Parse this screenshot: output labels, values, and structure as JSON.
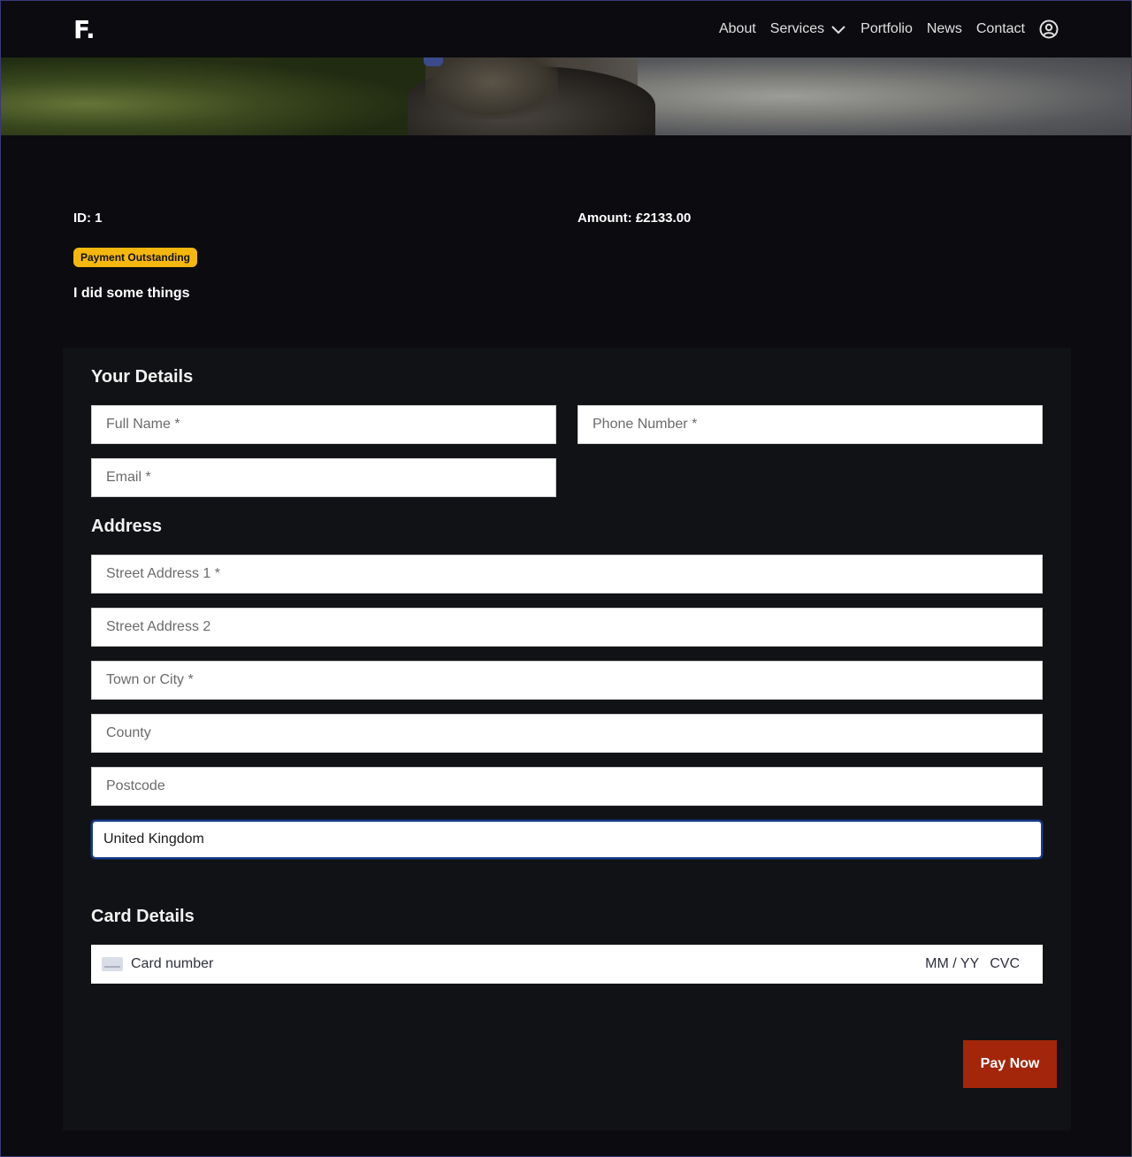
{
  "header": {
    "logo": "F.",
    "nav": [
      {
        "label": "About"
      },
      {
        "label": "Services"
      },
      {
        "label": "Portfolio"
      },
      {
        "label": "News"
      },
      {
        "label": "Contact"
      }
    ]
  },
  "invoice": {
    "id_text": "ID: 1",
    "amount_text": "Amount: £2133.00",
    "status_badge": "Payment Outstanding",
    "description": "I did some things"
  },
  "form": {
    "your_details_title": "Your Details",
    "full_name_placeholder": "Full Name *",
    "phone_placeholder": "Phone Number *",
    "email_placeholder": "Email *",
    "address_title": "Address",
    "street1_placeholder": "Street Address 1 *",
    "street2_placeholder": "Street Address 2",
    "town_placeholder": "Town or City *",
    "county_placeholder": "County",
    "postcode_placeholder": "Postcode",
    "country_value": "United Kingdom",
    "card_details_title": "Card Details",
    "card_number_placeholder": "Card number",
    "card_expiry_placeholder": "MM / YY",
    "card_cvc_placeholder": "CVC",
    "pay_button": "Pay Now"
  },
  "colors": {
    "accent_button": "#a3260a",
    "badge": "#f4b70e",
    "background": "#0b0b10",
    "panel": "#111216"
  }
}
